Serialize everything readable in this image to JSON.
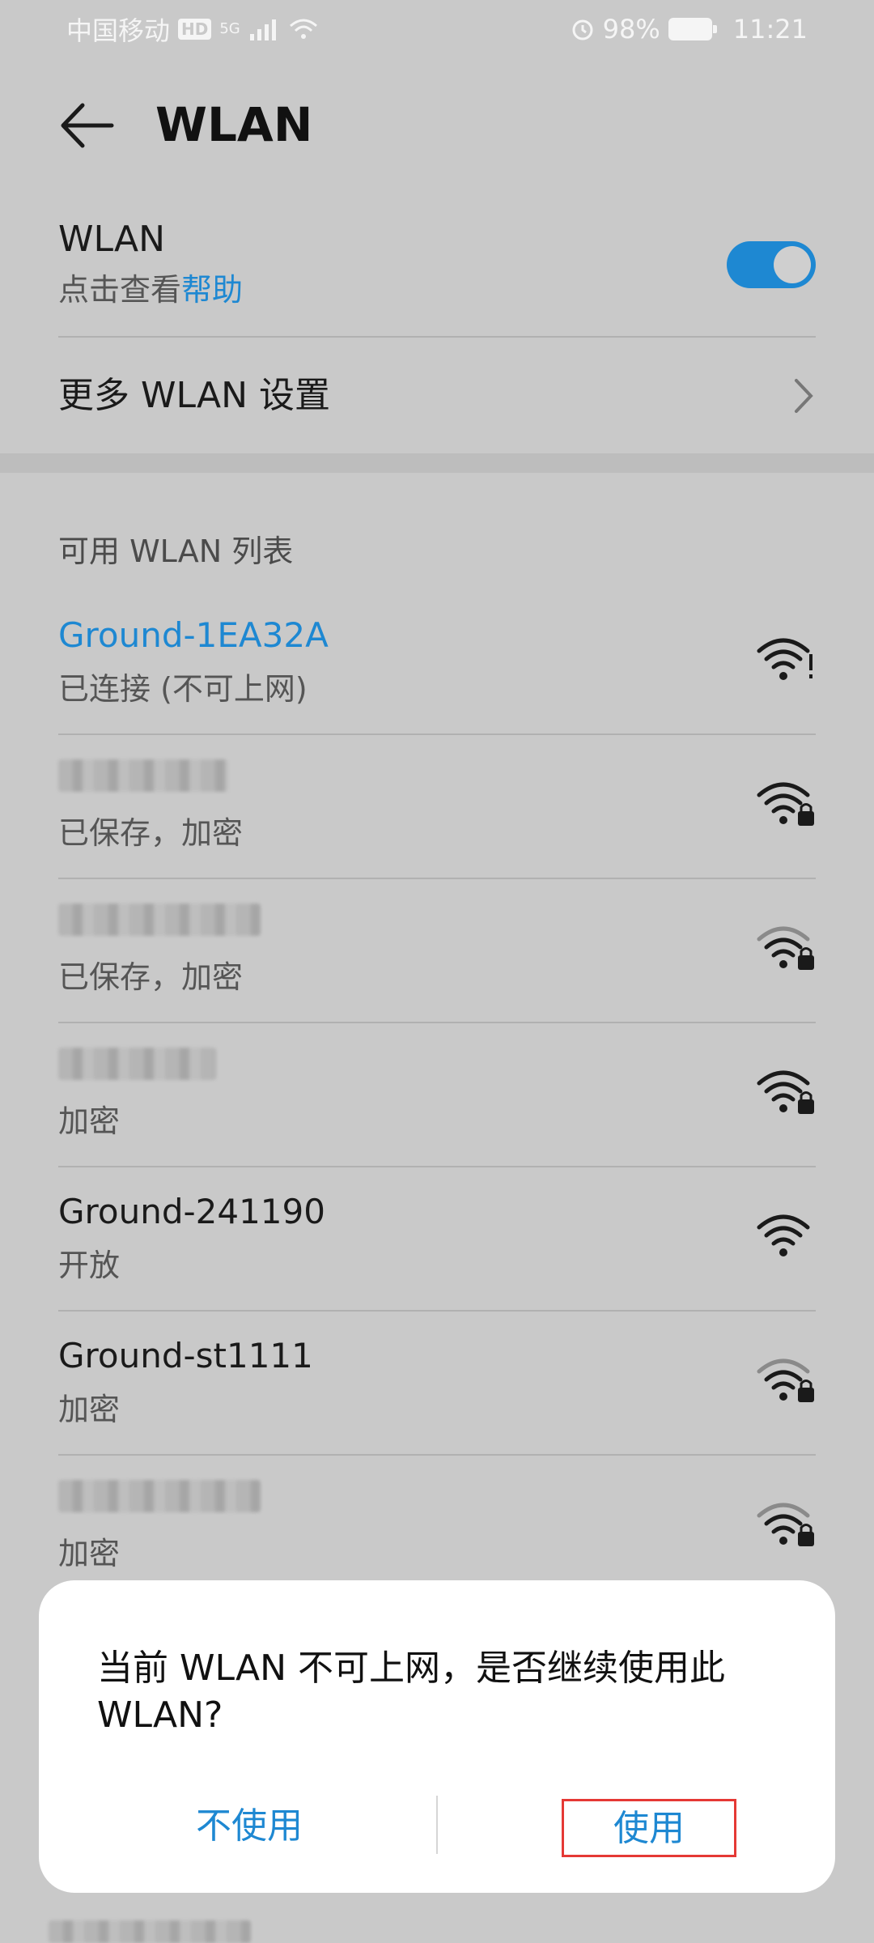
{
  "status_bar": {
    "carrier": "中国移动",
    "hd": "HD",
    "network": "5G",
    "battery": "98%",
    "time": "11:21"
  },
  "header": {
    "title": "WLAN",
    "back_icon": "arrow-left-icon"
  },
  "wlan_setting": {
    "label": "WLAN",
    "sub_prefix": "点击查看",
    "sub_link": "帮助",
    "enabled": true
  },
  "more_settings": {
    "label": "更多 WLAN 设置"
  },
  "list_header": "可用 WLAN 列表",
  "networks": [
    {
      "name": "Ground-1EA32A",
      "status": "已连接 (不可上网)",
      "connected": true,
      "blurred": false,
      "icon": "wifi-warning-icon"
    },
    {
      "name": "",
      "status": "已保存，加密",
      "connected": false,
      "blurred": true,
      "icon": "wifi-lock-icon"
    },
    {
      "name": "",
      "status": "已保存，加密",
      "connected": false,
      "blurred": true,
      "icon": "wifi-lock-icon"
    },
    {
      "name": "",
      "status": "加密",
      "connected": false,
      "blurred": true,
      "icon": "wifi-lock-icon"
    },
    {
      "name": "Ground-241190",
      "status": "开放",
      "connected": false,
      "blurred": false,
      "icon": "wifi-icon"
    },
    {
      "name": "Ground-st1111",
      "status": "加密",
      "connected": false,
      "blurred": false,
      "icon": "wifi-lock-icon"
    },
    {
      "name": "",
      "status": "加密",
      "connected": false,
      "blurred": true,
      "icon": "wifi-lock-icon"
    }
  ],
  "dialog": {
    "message": "当前 WLAN 不可上网，是否继续使用此 WLAN?",
    "cancel_label": "不使用",
    "confirm_label": "使用"
  },
  "colors": {
    "accent": "#1e88d2",
    "highlight_box": "#e53935"
  }
}
